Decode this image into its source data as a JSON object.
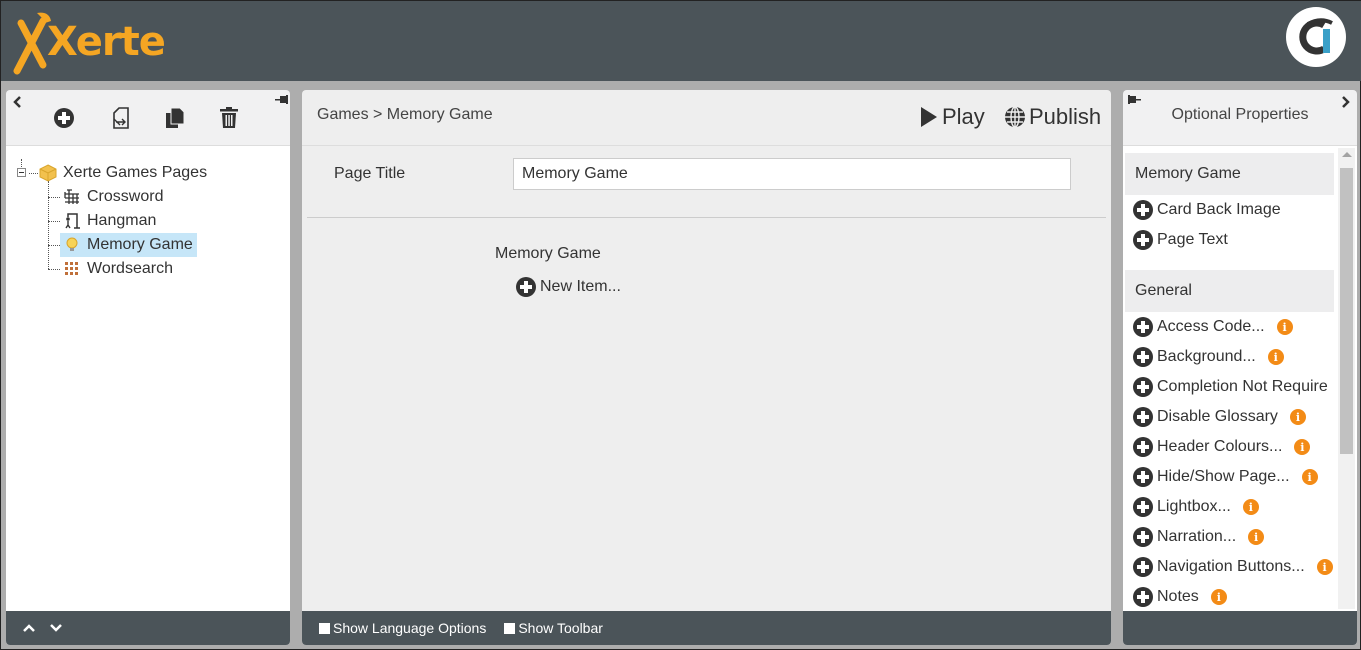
{
  "app": {
    "logo_text": "Xerte"
  },
  "left_panel": {
    "toolbar": {
      "collapse_icon": "chevron-left-icon",
      "pin_icon": "pin-icon",
      "actions": [
        {
          "name": "add-page-button",
          "icon": "plus-circle-icon"
        },
        {
          "name": "import-page-button",
          "icon": "import-file-icon"
        },
        {
          "name": "duplicate-page-button",
          "icon": "copy-icon"
        },
        {
          "name": "delete-page-button",
          "icon": "trash-icon"
        }
      ]
    },
    "tree": {
      "root": {
        "label": "Xerte Games Pages",
        "icon": "package-icon",
        "expanded": true
      },
      "children": [
        {
          "label": "Crossword",
          "icon": "crossword-icon",
          "selected": false
        },
        {
          "label": "Hangman",
          "icon": "hangman-icon",
          "selected": false
        },
        {
          "label": "Memory Game",
          "icon": "lightbulb-icon",
          "selected": true
        },
        {
          "label": "Wordsearch",
          "icon": "wordsearch-icon",
          "selected": false
        }
      ]
    },
    "footer": {
      "up_icon": "chevron-up-icon",
      "down_icon": "chevron-down-icon"
    }
  },
  "center_panel": {
    "breadcrumb": "Games > Memory Game",
    "play_label": "Play",
    "publish_label": "Publish",
    "page_title_label": "Page Title",
    "page_title_value": "Memory Game",
    "section_label": "Memory Game",
    "new_item_label": "New Item...",
    "footer": {
      "show_language_options": {
        "label": "Show Language Options",
        "checked": false
      },
      "show_toolbar": {
        "label": "Show Toolbar",
        "checked": false
      }
    }
  },
  "right_panel": {
    "title": "Optional Properties",
    "groups": [
      {
        "title": "Memory Game",
        "items": [
          {
            "label": "Card Back Image",
            "info": false
          },
          {
            "label": "Page Text",
            "info": false
          }
        ]
      },
      {
        "title": "General",
        "items": [
          {
            "label": "Access Code...",
            "info": true
          },
          {
            "label": "Background...",
            "info": true
          },
          {
            "label": "Completion Not Require",
            "info": false
          },
          {
            "label": "Disable Glossary",
            "info": true
          },
          {
            "label": "Header Colours...",
            "info": true
          },
          {
            "label": "Hide/Show Page...",
            "info": true
          },
          {
            "label": "Lightbox...",
            "info": true
          },
          {
            "label": "Narration...",
            "info": true
          },
          {
            "label": "Navigation Buttons...",
            "info": true
          },
          {
            "label": "Notes",
            "info": true
          }
        ]
      }
    ],
    "info_glyph": "i"
  },
  "colors": {
    "header_bg": "#4b5459",
    "logo": "#f5a623",
    "info_badge": "#f38b16",
    "selected_row": "#c6e6f8"
  }
}
